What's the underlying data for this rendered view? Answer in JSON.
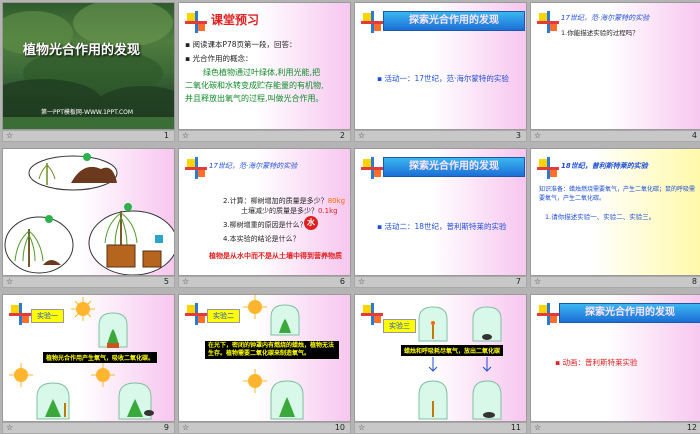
{
  "slides": [
    {
      "num": "1",
      "title": "植物光合作用的发现",
      "footer": "第一PPT模板网-WWW.1PPT.COM"
    },
    {
      "num": "2",
      "heading": "课堂预习",
      "bullet1": "阅读课本P78页第一段，回答：",
      "bullet2": "光合作用的概念：",
      "concept_lines": [
        "绿色植物通过叶绿体,利用光能,把",
        "二氧化碳和水转变成贮存能量的有机物,",
        "并且释放出氧气的过程,叫做光合作用。"
      ]
    },
    {
      "num": "3",
      "banner": "探索光合作用的发现",
      "activity": "活动一：17世纪，范·海尔蒙特的实验"
    },
    {
      "num": "4",
      "heading": "17世纪，范·海尔蒙特的实验",
      "question": "1.你能描述实验的过程吗？"
    },
    {
      "num": "5"
    },
    {
      "num": "6",
      "heading": "17世纪，范·海尔蒙特的实验",
      "q2a": "2.计算：柳树增加的质量是多少？",
      "q2a_ans": "80kg",
      "q2b": "土壤减少的质量是多少？",
      "q2b_ans": "0.1kg",
      "q3": "3.柳树增重的原因是什么？",
      "water": "水",
      "q4": "4.本实验的结论是什么？",
      "conclusion": "植物是从水中而不是从土壤中得到营养物质"
    },
    {
      "num": "7",
      "banner": "探索光合作用的发现",
      "activity": "活动二：18世纪，普利斯特莱的实验"
    },
    {
      "num": "8",
      "heading": "18世纪，普利斯特莱的实验",
      "knowledge": "知识准备：蜡烛燃烧需要氧气，产生二氧化碳；鼠的呼吸需要氧气，产生二氧化碳。",
      "task": "1.请你描述实验一、实验二、实验三。"
    },
    {
      "num": "9",
      "label": "实验一",
      "caption": "植物光合作用产生氧气，吸收二氧化碳。"
    },
    {
      "num": "10",
      "label": "实验二",
      "caption": "在光下，密闭的钟罩内有燃烧的蜡烛，植物无法生存。植物需要二氧化碳来制造氧气。"
    },
    {
      "num": "11",
      "label": "实验三",
      "caption": "蜡烛和呼吸耗尽氧气，放出二氧化碳"
    },
    {
      "num": "12",
      "banner": "探索光合作用的发现",
      "activity": "动画：普利斯特莱实验"
    }
  ],
  "colors": {
    "accent": "#1e4fd6",
    "highlight": "#ffff00",
    "red": "#e02020",
    "green": "#118a2a"
  }
}
